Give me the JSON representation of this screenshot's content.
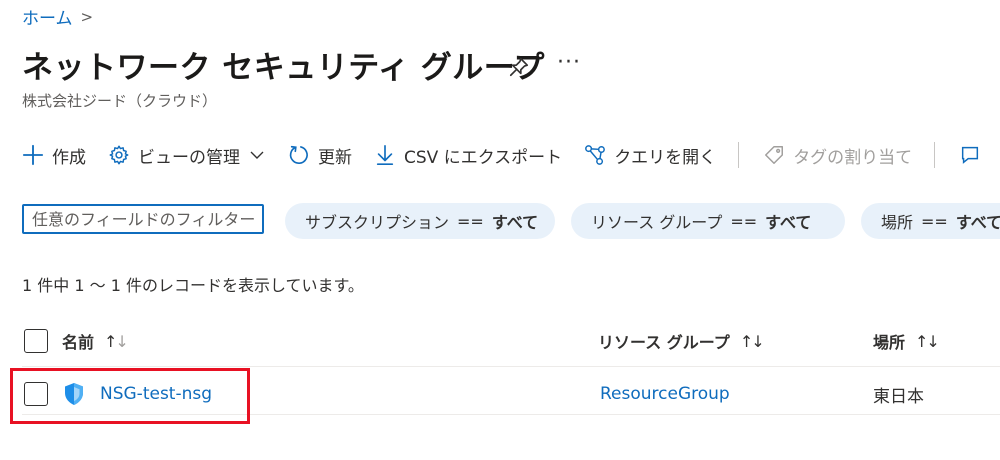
{
  "breadcrumb": {
    "home": "ホーム",
    "separator": ">"
  },
  "page": {
    "title": "ネットワーク セキュリティ グループ",
    "subtitle": "株式会社ジード（クラウド）",
    "more_label": "···"
  },
  "toolbar": {
    "create": "作成",
    "manage_view": "ビューの管理",
    "refresh": "更新",
    "export_csv": "CSV にエクスポート",
    "open_query": "クエリを開く",
    "assign_tags": "タグの割り当て"
  },
  "filters": {
    "search_placeholder": "任意のフィールドのフィルター...",
    "subscription": {
      "label": "サブスクリプション",
      "op": "==",
      "value": "すべて"
    },
    "resource_group": {
      "label": "リソース グループ",
      "op": "==",
      "value": "すべて"
    },
    "location": {
      "label": "場所",
      "op": "==",
      "value": "すべて"
    }
  },
  "record_count": "1 件中 1 ～ 1 件のレコードを表示しています。",
  "table": {
    "columns": {
      "name": "名前",
      "resource_group": "リソース グループ",
      "location": "場所"
    },
    "rows": [
      {
        "name": "NSG-test-nsg",
        "resource_group": "ResourceGroup",
        "location": "東日本"
      }
    ]
  },
  "icons": {
    "add": "plus-icon",
    "view": "gear-icon",
    "refresh": "refresh-icon",
    "export": "download-icon",
    "query": "query-icon",
    "tag": "tag-icon",
    "pin": "pin-icon",
    "row": "shield-icon"
  },
  "colors": {
    "accent": "#0f6cbd",
    "pill_bg": "#e8f1fa",
    "highlight": "#e81123"
  }
}
